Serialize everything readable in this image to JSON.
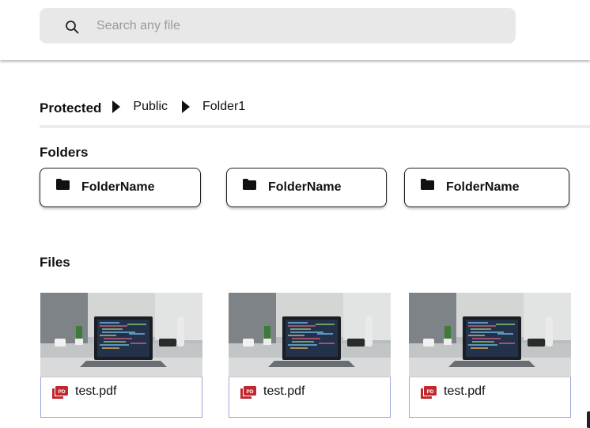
{
  "search": {
    "placeholder": "Search any file",
    "value": ""
  },
  "breadcrumb": [
    "Protected",
    "Public",
    "Folder1"
  ],
  "sections": {
    "folders": "Folders",
    "files": "Files"
  },
  "folders": [
    "FolderName",
    "FolderName",
    "FolderName"
  ],
  "files": [
    "test.pdf",
    "test.pdf",
    "test.pdf"
  ],
  "icons": {
    "search": "search-icon",
    "folder": "folder-icon",
    "pdf": "pdf-icon",
    "breadcrumb_sep": "caret-right-icon"
  },
  "colors": {
    "search_bg": "#e8e8e8",
    "pdf_red": "#c0282d",
    "card_border": "#9aa6d8"
  }
}
